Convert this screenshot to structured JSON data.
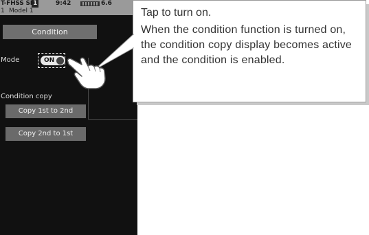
{
  "status_bar": {
    "system": "T-FHSS SR",
    "model_number": "1",
    "time": "9:42",
    "battery_icon": "battery-icon",
    "voltage": "6.6",
    "model_index": "1",
    "model_name": "Model 1"
  },
  "screen": {
    "title": "Condition",
    "mode_label": "Mode",
    "mode_value": "ON",
    "copy_label": "Condition copy",
    "copy_buttons": [
      "Copy 1st to 2nd",
      "Copy 2nd to 1st"
    ]
  },
  "callout": {
    "title": "Tap to turn on.",
    "body": "When the condition function is turned on, the condition copy display becomes active and the condition is enabled."
  },
  "icons": {
    "hand": "tapping-hand-icon"
  },
  "colors": {
    "screen_bg": "#111111",
    "button_bg": "#6a6a6a",
    "callout_text": "#333333"
  }
}
